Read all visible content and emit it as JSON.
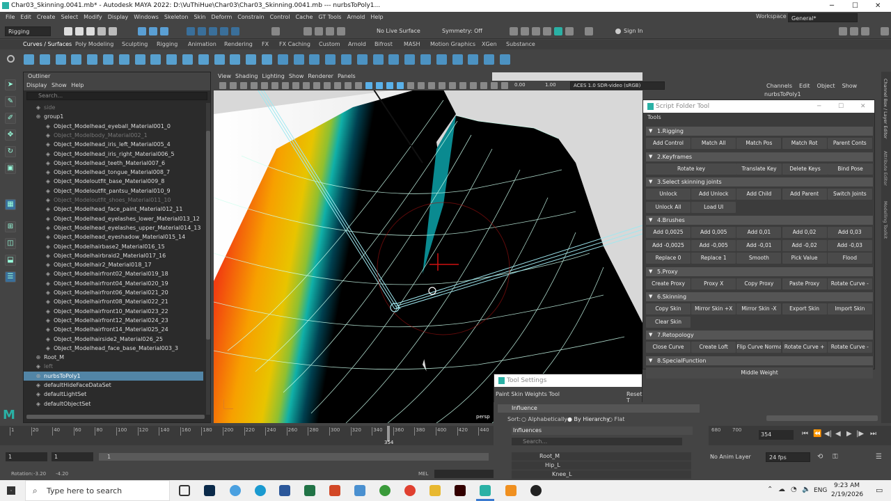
{
  "window": {
    "title": "Char03_Skinning.0041.mb* - Autodesk MAYA 2022: D:\\VuThiHue\\Char03\\Char03_Skinning.0041.mb   ---   nurbsToPoly1..."
  },
  "menubar": [
    "File",
    "Edit",
    "Create",
    "Select",
    "Modify",
    "Display",
    "Windows",
    "Skeleton",
    "Skin",
    "Deform",
    "Constrain",
    "Control",
    "Cache",
    "GT Tools",
    "Arnold",
    "Help"
  ],
  "workspace": {
    "label": "Workspace :",
    "value": "General*"
  },
  "status": {
    "menuset": "Rigging",
    "live_surface": "No Live Surface",
    "symmetry": "Symmetry: Off",
    "sign_in": "Sign In"
  },
  "shelf_tabs": [
    "Curves / Surfaces",
    "Poly Modeling",
    "Sculpting",
    "Rigging",
    "Animation",
    "Rendering",
    "FX",
    "FX Caching",
    "Custom",
    "Arnold",
    "Bifrost",
    "MASH",
    "Motion Graphics",
    "XGen",
    "Substance"
  ],
  "outliner": {
    "title": "Outliner",
    "menus": [
      "Display",
      "Show",
      "Help"
    ],
    "search_placeholder": "Search...",
    "rows": [
      {
        "label": "side",
        "dim": true
      },
      {
        "label": "group1"
      },
      {
        "label": "Object_Modelhead_eyeball_Material001_0"
      },
      {
        "label": "Object_Modelbody_Material002_1",
        "dim": true
      },
      {
        "label": "Object_Modelhead_iris_left_Material005_4"
      },
      {
        "label": "Object_Modelhead_iris_right_Material006_5"
      },
      {
        "label": "Object_Modelhead_teeth_Material007_6"
      },
      {
        "label": "Object_Modelhead_tongue_Material008_7"
      },
      {
        "label": "Object_Modeloutfit_base_Material009_8"
      },
      {
        "label": "Object_Modeloutfit_pantsu_Material010_9"
      },
      {
        "label": "Object_Modeloutfit_shoes_Material011_10",
        "dim": true
      },
      {
        "label": "Object_Modelhead_face_paint_Material012_11"
      },
      {
        "label": "Object_Modelhead_eyelashes_lower_Material013_12"
      },
      {
        "label": "Object_Modelhead_eyelashes_upper_Material014_13"
      },
      {
        "label": "Object_Modelhead_eyeshadow_Material015_14"
      },
      {
        "label": "Object_Modelhairbase2_Material016_15"
      },
      {
        "label": "Object_Modelhairbraid2_Material017_16"
      },
      {
        "label": "Object_Modelhair2_Material018_17"
      },
      {
        "label": "Object_Modelhairfront02_Material019_18"
      },
      {
        "label": "Object_Modelhairfront04_Material020_19"
      },
      {
        "label": "Object_Modelhairfront06_Material021_20"
      },
      {
        "label": "Object_Modelhairfront08_Material022_21"
      },
      {
        "label": "Object_Modelhairfront10_Material023_22"
      },
      {
        "label": "Object_Modelhairfront12_Material024_23"
      },
      {
        "label": "Object_Modelhairfront14_Material025_24"
      },
      {
        "label": "Object_Modelhairside2_Material026_25"
      },
      {
        "label": "Object_Modelhead_face_base_Material003_3"
      },
      {
        "label": "Root_M"
      },
      {
        "label": "left",
        "dim": true
      },
      {
        "label": "nurbsToPoly1",
        "selected": true
      },
      {
        "label": "defaultHideFaceDataSet"
      },
      {
        "label": "defaultLightSet"
      },
      {
        "label": "defaultObjectSet"
      }
    ]
  },
  "viewport": {
    "menus": [
      "View",
      "Shading",
      "Lighting",
      "Show",
      "Renderer",
      "Panels"
    ],
    "exposure": "0.00",
    "gamma": "1.00",
    "colorspace": "ACES 1.0 SDR-video (sRGB)",
    "camera": "persp"
  },
  "channel_box": {
    "menus": [
      "Channels",
      "Edit",
      "Object",
      "Show"
    ],
    "object": "nurbsToPoly1"
  },
  "side_tabs": [
    "Channel Box / Layer Editor",
    "Attribute Editor",
    "Modelling Toolkit"
  ],
  "script_folder_tool": {
    "title": "Script Folder Tool",
    "tools_label": "Tools",
    "sections": [
      {
        "title": "1.Rigging",
        "rows": [
          [
            "Add Control",
            "Match All",
            "Match Pos",
            "Match Rot",
            "Parent Conts"
          ]
        ]
      },
      {
        "title": "2.Keyframes",
        "rows": [
          [
            "Rotate key",
            "Translate Key",
            "Delete Keys",
            "Bind Pose"
          ]
        ]
      },
      {
        "title": "3.Select skinning joints",
        "rows": [
          [
            "Unlock",
            "Add Unlock",
            "Add Child",
            "Add Parent",
            "Switch Joints"
          ],
          [
            "Unlock All",
            "Load UI"
          ]
        ]
      },
      {
        "title": "4.Brushes",
        "rows": [
          [
            "Add 0,0025",
            "Add 0,005",
            "Add 0,01",
            "Add 0,02",
            "Add 0,03"
          ],
          [
            "Add -0,0025",
            "Add -0,005",
            "Add -0,01",
            "Add -0,02",
            "Add -0,03"
          ],
          [
            "Replace 0",
            "Replace 1",
            "Smooth",
            "Pick Value",
            "Flood"
          ]
        ]
      },
      {
        "title": "5.Proxy",
        "rows": [
          [
            "Create Proxy",
            "Proxy X",
            "Copy Proxy",
            "Paste Proxy",
            "Rotate Curve -"
          ]
        ]
      },
      {
        "title": "6.Skinning",
        "rows": [
          [
            "Copy Skin",
            "Mirror Skin +X",
            "Mirror Skin -X",
            "Export Skin",
            "Import Skin"
          ],
          [
            "Clear Skin"
          ]
        ]
      },
      {
        "title": "7.Retopology",
        "rows": [
          [
            "Close Curve",
            "Create Loft",
            "Flip Curve Normal",
            "Rotate Curve +",
            "Rotate Curve -"
          ]
        ]
      },
      {
        "title": "8.SpecialFunction",
        "rows": [
          [
            "Middle Weight"
          ]
        ]
      }
    ]
  },
  "tool_settings": {
    "title": "Tool Settings",
    "tool_name": "Paint Skin Weights Tool",
    "reset": "Reset T",
    "influence": "Influence",
    "sort_label": "Sort:",
    "sort_options": [
      "Alphabetically",
      "By Hierarchy",
      "Flat"
    ],
    "influences_label": "Influences",
    "search_placeholder": "Search...",
    "joints": [
      "Root_M",
      "Hip_L",
      "Knee_L"
    ]
  },
  "timeline": {
    "ticks": [
      "1",
      "20",
      "40",
      "60",
      "80",
      "100",
      "120",
      "140",
      "160",
      "180",
      "200",
      "220",
      "240",
      "260",
      "280",
      "300",
      "320",
      "340",
      "360",
      "380",
      "400",
      "420",
      "440"
    ],
    "right_ticks": [
      "680",
      "700"
    ],
    "current": "354",
    "current_frame_field": "354"
  },
  "range": {
    "start": "1",
    "start2": "1",
    "mid": "1",
    "anim_layer": "No Anim Layer",
    "fps": "24 fps"
  },
  "cmdline": {
    "rotation_label": "Rotation:",
    "rx": "-3.20",
    "ry": "-4.20",
    "lang": "MEL"
  },
  "taskbar": {
    "search": "Type here to search",
    "lang": "ENG",
    "time": "9:23 AM",
    "date": "2/19/2026"
  }
}
